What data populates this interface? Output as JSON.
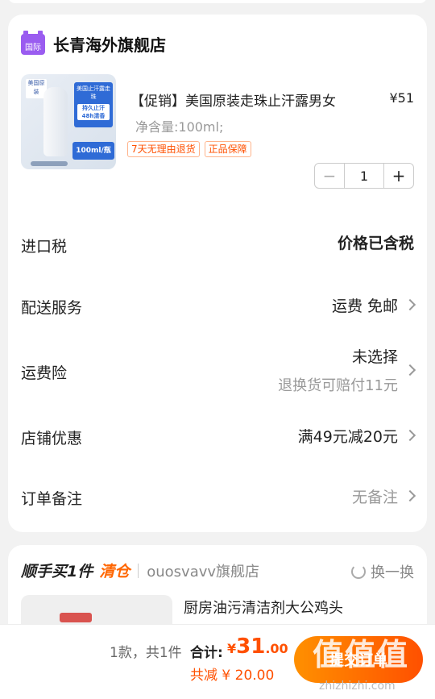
{
  "store": {
    "badge": "国际",
    "name": "长青海外旗舰店"
  },
  "product": {
    "image": {
      "badge": "美国原装",
      "panel_line1": "美国止汗露走珠",
      "panel_line2": "持久止汗 48h清香",
      "size": "100ml/瓶"
    },
    "title": "【促销】美国原装走珠止汗露男女",
    "price": "¥51",
    "spec": "净含量:100ml;",
    "tags": [
      "7天无理由退货",
      "正品保障"
    ],
    "quantity": "1",
    "minus": "−",
    "plus": "+"
  },
  "rows": {
    "tax": {
      "label": "进口税",
      "value": "价格已含税"
    },
    "shipping": {
      "label": "配送服务",
      "value": "运费 免邮"
    },
    "insurance": {
      "label": "运费险",
      "value": "未选择",
      "sub": "退换货可赔付11元"
    },
    "discount": {
      "label": "店铺优惠",
      "value": "满49元减20元"
    },
    "note": {
      "label": "订单备注",
      "value": "无备注"
    }
  },
  "addon": {
    "title": "顺手买1件",
    "clearance": "清仓",
    "store": "ouosvavv旗舰店",
    "swap": "换一换",
    "product_name": "厨房油污清洁剂大公鸡头"
  },
  "bottom": {
    "count": "1款，共1件",
    "total_label": "合计:",
    "total_currency": "¥",
    "total_int": "31",
    "total_dec": ".00",
    "saved": "共减 ¥ 20.00",
    "submit": "提交订单",
    "watermark": "值值值",
    "watermark_url": "zhizhizhi.com"
  },
  "colors": {
    "accent": "#ff5000",
    "tmall": "#9a5cf0"
  }
}
